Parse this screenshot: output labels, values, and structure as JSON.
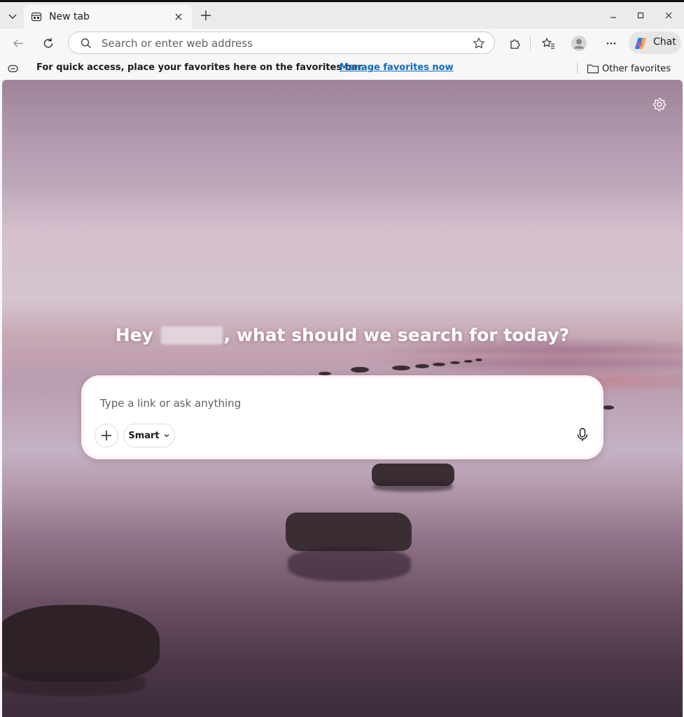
{
  "tabs": [
    {
      "title": "New tab",
      "active": true
    }
  ],
  "toolbar": {
    "address_placeholder": "Search or enter web address",
    "chat_label": "Chat"
  },
  "favorites_bar": {
    "message": "For quick access, place your favorites here on the favorites bar.",
    "manage_link": "Manage favorites now",
    "other_favorites": "Other favorites"
  },
  "newtab": {
    "greeting_prefix": "Hey",
    "greeting_suffix": ", what should we search for today?",
    "search_placeholder": "Type a link or ask anything",
    "mode_label": "Smart"
  },
  "colors": {
    "link": "#0f6cbd",
    "tabstrip_bg": "#ebebeb",
    "toolbar_bg": "#f7f7f7"
  }
}
